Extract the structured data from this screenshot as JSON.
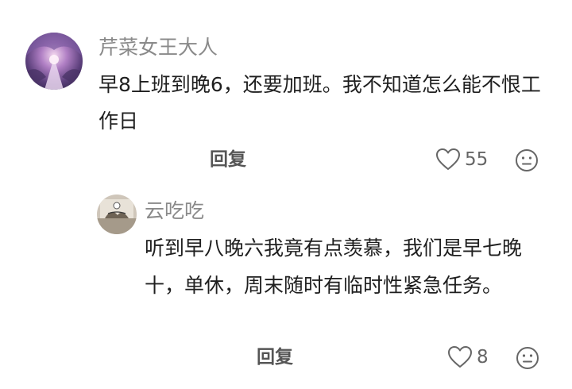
{
  "comment": {
    "author": "芹菜女王大人",
    "text": "早8上班到晚6，还要加班。我不知道怎么能不恨工作日",
    "reply_label": "回复",
    "like_count": "55",
    "icons": {
      "like": "heart-outline-icon",
      "react": "neutral-face-icon"
    }
  },
  "reply": {
    "author": "云吃吃",
    "text": "听到早八晚六我竟有点羡慕，我们是早七晚十，单休，周末随时有临时性紧急任务。",
    "reply_label": "回复",
    "like_count": "8",
    "icons": {
      "like": "heart-outline-icon",
      "react": "neutral-face-icon"
    }
  },
  "colors": {
    "author_name": "#8a8a8a",
    "body_text": "#1f1f1f",
    "action_text": "#555555",
    "icon_stroke": "#666666"
  }
}
